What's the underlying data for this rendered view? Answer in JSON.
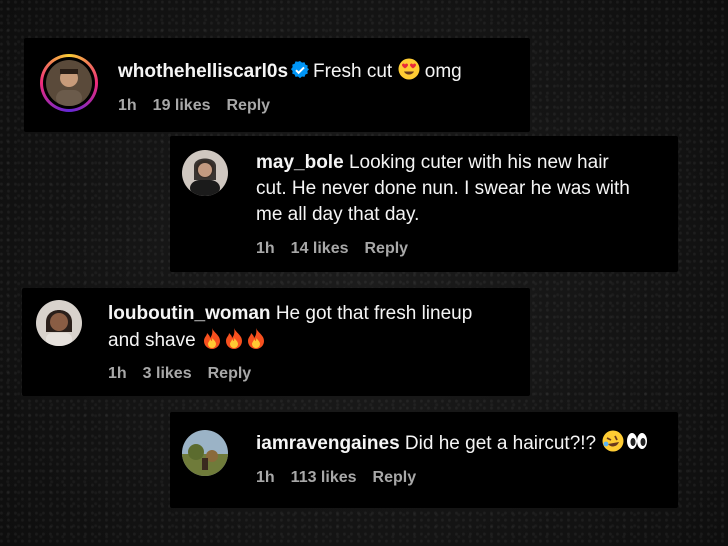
{
  "comments": [
    {
      "username": "whothehelliscarl0s",
      "text_before_emoji": "Fresh cut",
      "text_after_emoji": "omg",
      "emoji": "heart-eyes-emoji",
      "verified": true,
      "time": "1h",
      "likes": "19 likes",
      "reply": "Reply"
    },
    {
      "username": "may_bole",
      "line1": "Looking cuter with his new hair",
      "line2": "cut. He never done nun. I swear he was with",
      "line3": "me all day that day.",
      "time": "1h",
      "likes": "14 likes",
      "reply": "Reply"
    },
    {
      "username": "louboutin_woman",
      "line1": "He got that fresh lineup",
      "line2": "and shave",
      "emoji": "fire-emoji x3",
      "time": "1h",
      "likes": "3 likes",
      "reply": "Reply"
    },
    {
      "username": "iamravengaines",
      "text": "Did he get a haircut?!?",
      "emoji": "rofl-emoji, eyes-emoji",
      "time": "1h",
      "likes": "113 likes",
      "reply": "Reply"
    }
  ],
  "colors": {
    "card_bg": "#000000",
    "text": "#f5f5f5",
    "meta": "#a8a8a8",
    "verified": "#0095f6"
  }
}
